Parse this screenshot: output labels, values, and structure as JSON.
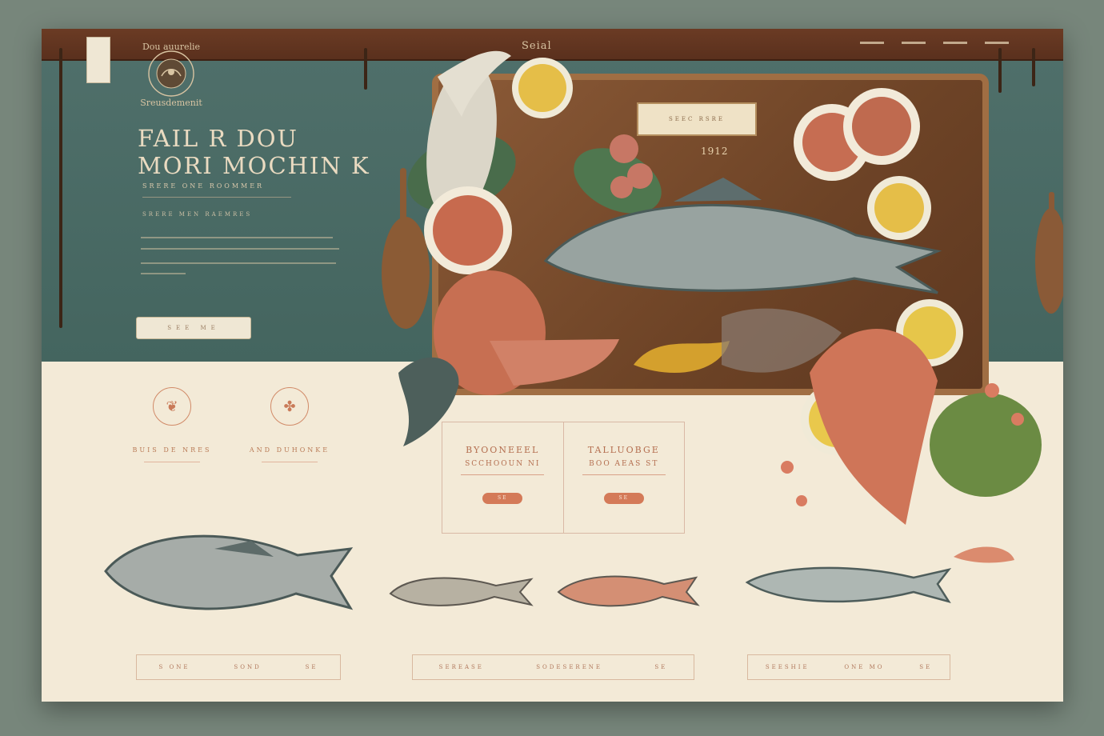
{
  "header": {
    "brand": "Seial",
    "emblem_text_top": "Dou auurelie",
    "emblem_text_bottom": "Sreusdemenit",
    "nav_items": [
      "",
      "",
      "",
      ""
    ]
  },
  "hero": {
    "title_line1": "FAIL R DOU",
    "title_line2": "MORI MOCHIN K",
    "subtitle": "SRERE ONE ROOMMER",
    "line": "SRERE MEN RAEMRES",
    "button_label": "SEE ME",
    "board_label": "SEEC RSRE",
    "board_year": "1912"
  },
  "features": [
    {
      "title": "BUIS DE NRES"
    },
    {
      "title": "AND DUHONKE"
    }
  ],
  "panels": [
    {
      "title": "BYOONEEEL",
      "subtitle": "SCCHOOUN NI",
      "button": "SE"
    },
    {
      "title": "TALLUOBGE",
      "subtitle": "BOO AEAS ST",
      "button": "SE"
    }
  ],
  "bottom_bars": [
    [
      "S ONE",
      "SOND",
      "SE"
    ],
    [
      "SEREASE",
      "SODESERENE",
      "SE"
    ],
    [
      "SEESHIE",
      "ONE MO",
      "SE"
    ]
  ],
  "colors": {
    "hero_bg": "#4b6b65",
    "rail": "#5a301d",
    "paper": "#f3ead7",
    "accent": "#d47a58"
  }
}
